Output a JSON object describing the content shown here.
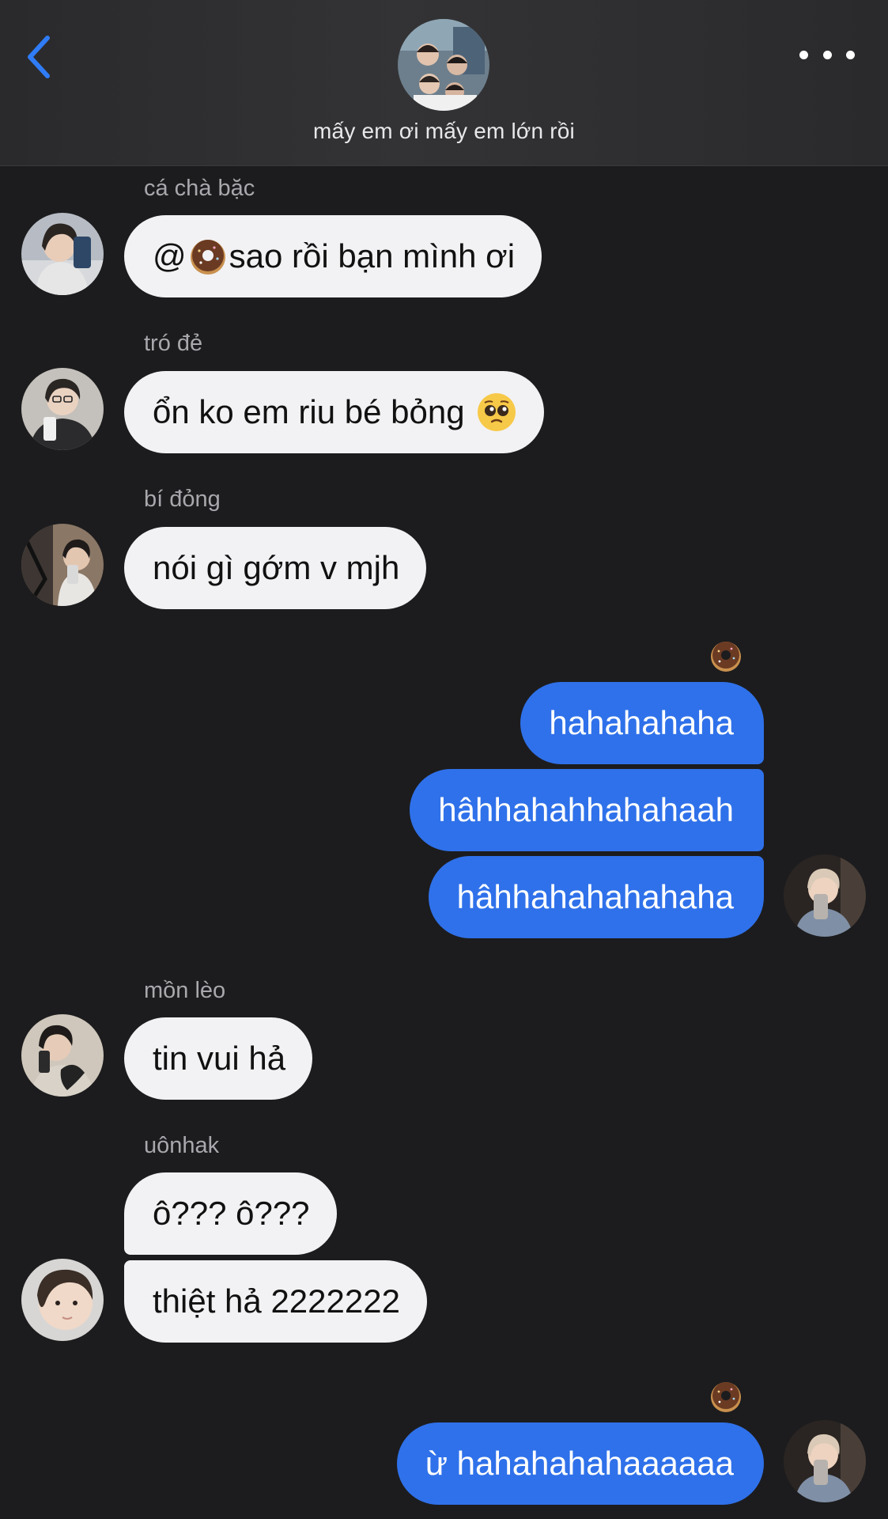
{
  "header": {
    "group_title": "mấy em ơi mấy em lớn rồi"
  },
  "colors": {
    "background": "#1c1c1e",
    "incoming_bubble": "#f2f2f4",
    "outgoing_bubble": "#2f71ea",
    "accent": "#2f7cf6"
  },
  "messages": [
    {
      "sender": "cá chà bặc",
      "mention_prefix": "@",
      "text": " sao rồi bạn mình ơi"
    },
    {
      "sender": "tró đẻ",
      "text": "ổn ko em riu bé bỏng"
    },
    {
      "sender": "bí đỏng",
      "text": "nói gì gớm v mjh"
    },
    {
      "outgoing_group": [
        "hahahahaha",
        "hâhhahahhahahaah",
        "hâhhahahahahaha"
      ]
    },
    {
      "sender": "mồn lèo",
      "text": "tin vui hả"
    },
    {
      "sender": "uônhak",
      "texts": [
        "ô??? ô???",
        "thiệt hả 2222222"
      ]
    },
    {
      "outgoing_single": "ừ hahahahahaaaaaa"
    }
  ],
  "icons": [
    "back-chevron-icon",
    "more-dots-icon",
    "donut-emoji-icon",
    "pleading-face-emoji-icon"
  ]
}
